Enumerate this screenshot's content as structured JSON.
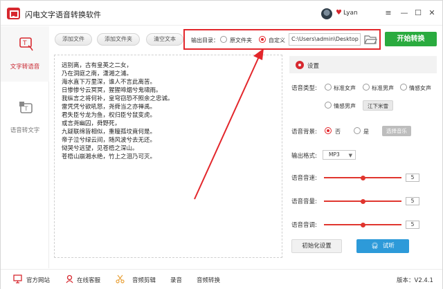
{
  "app": {
    "title": "闪电文字语音转换软件"
  },
  "user": {
    "name": "Lyan"
  },
  "window_controls": {
    "menu": "≡",
    "minimize": "—",
    "maximize": "☐",
    "close": "✕"
  },
  "nav": {
    "items": [
      {
        "label": "文字转语音",
        "active": true
      },
      {
        "label": "语音转文字",
        "active": false
      }
    ]
  },
  "toolbar": {
    "add_file": "添加文件",
    "add_folder": "添加文件夹",
    "clear_text": "清空文本",
    "output_label": "输出目录：",
    "radio_source": "原文件夹",
    "radio_custom": "自定义",
    "output_path": "C:\\Users\\admin\\Desktop",
    "start": "开始转换"
  },
  "text_lines": [
    "远别离，古有皇英之二女，",
    "乃在洞庭之南，潇湘之浦。",
    "海水直下万里深，谁人不言此离苦。",
    "日惨惨兮云冥冥，猩猩啼烟兮鬼啸雨。",
    "我纵言之将何补，皇穹窃恐不照余之忠诚。",
    "雷凭凭兮欲吼怒，尧舜当之亦禅禹。",
    "君失臣兮龙为鱼，权归臣兮鼠变虎。",
    "或言尧幽囚，舜野死，",
    "九疑联绵皆相似，重瞳孤坟竟何是。",
    "帝子泣兮绿云间，随风波兮去无还。",
    "恸哭兮远望，见苍梧之深山。",
    "苍梧山崩湘水绝，竹上之泪乃可灭。"
  ],
  "settings": {
    "title": "设置",
    "voice_type_label": "语音类型:",
    "voice_options": [
      "标准女声",
      "标准男声",
      "情感女声",
      "情感男声"
    ],
    "voice_preset": "江下米雪",
    "bg_label": "语音背景:",
    "bg_no": "否",
    "bg_yes": "是",
    "choose_music": "选择音乐",
    "format_label": "输出格式:",
    "format_value": "MP3",
    "speed_label": "语音音速:",
    "speed_value": "5",
    "volume_label": "语音音量:",
    "volume_value": "5",
    "pitch_label": "语音音调:",
    "pitch_value": "5",
    "slider_fraction": 0.5,
    "reset": "初始化设置",
    "listen": "试听"
  },
  "statusbar": {
    "website": "官方网站",
    "service": "在线客服",
    "audio_cut": "音频剪辑",
    "record": "录音",
    "audio_convert": "音频转换",
    "version": "版本：V2.4.1"
  },
  "colors": {
    "brand_red": "#d7282f",
    "annotation_red": "#e3262b",
    "start_green": "#2aab3f",
    "listen_blue": "#2d9ad9"
  }
}
